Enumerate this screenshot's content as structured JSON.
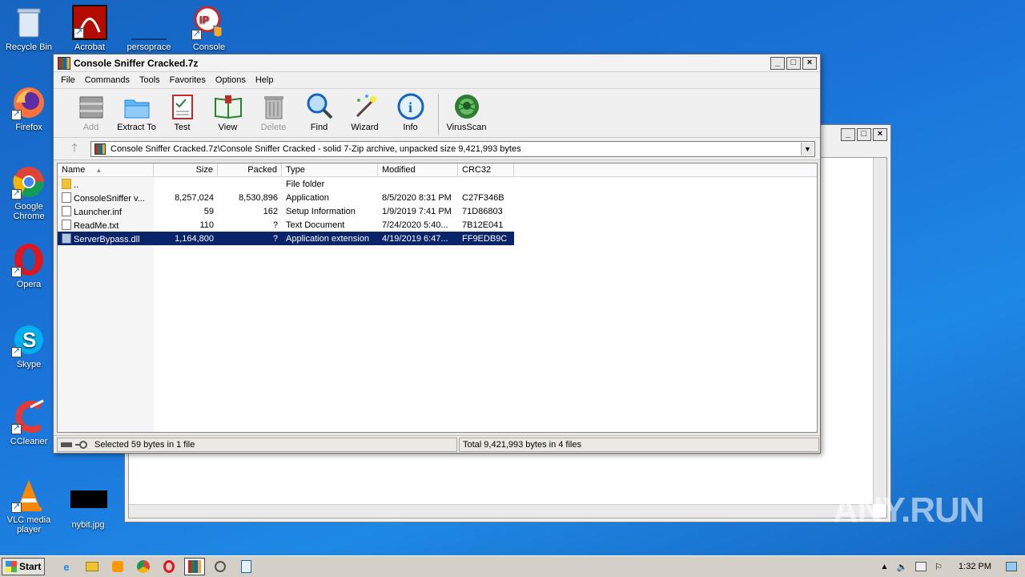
{
  "desktop": {
    "icons": [
      {
        "label": "Recycle Bin",
        "icon": "recycle-bin"
      },
      {
        "label": "Acrobat",
        "icon": "acrobat"
      },
      {
        "label": "persoprace",
        "icon": "blank-file"
      },
      {
        "label": "Console",
        "icon": "ip-console"
      },
      {
        "label": "Firefox",
        "icon": "firefox"
      },
      {
        "label": "Google Chrome",
        "icon": "chrome"
      },
      {
        "label": "Opera",
        "icon": "opera"
      },
      {
        "label": "Skype",
        "icon": "skype"
      },
      {
        "label": "CCleaner",
        "icon": "ccleaner"
      },
      {
        "label": "VLC media player",
        "icon": "vlc"
      },
      {
        "label": "nybit.jpg",
        "icon": "image-file"
      }
    ]
  },
  "window": {
    "title": "Console Sniffer Cracked.7z",
    "controls": [
      "_",
      "□",
      "×"
    ]
  },
  "menu": [
    "File",
    "Commands",
    "Tools",
    "Favorites",
    "Options",
    "Help"
  ],
  "toolbar": [
    {
      "label": "Add",
      "icon": "add-archive-icon",
      "disabled": true
    },
    {
      "label": "Extract To",
      "icon": "extract-folder-icon",
      "disabled": false
    },
    {
      "label": "Test",
      "icon": "test-checklist-icon",
      "disabled": false
    },
    {
      "label": "View",
      "icon": "view-book-icon",
      "disabled": false
    },
    {
      "label": "Delete",
      "icon": "delete-trash-icon",
      "disabled": true
    },
    {
      "label": "Find",
      "icon": "find-magnifier-icon",
      "disabled": false
    },
    {
      "label": "Wizard",
      "icon": "wizard-wand-icon",
      "disabled": false
    },
    {
      "label": "Info",
      "icon": "info-icon",
      "disabled": false
    },
    {
      "label": "VirusScan",
      "icon": "virus-scan-icon",
      "disabled": false
    }
  ],
  "address": {
    "path": "Console Sniffer Cracked.7z\\Console Sniffer Cracked - solid 7-Zip archive, unpacked size 9,421,993 bytes"
  },
  "table": {
    "columns": [
      "Name",
      "Size",
      "Packed",
      "Type",
      "Modified",
      "CRC32"
    ],
    "rows": [
      {
        "name": "..",
        "size": "",
        "packed": "",
        "type": "File folder",
        "modified": "",
        "crc": "",
        "icon": "folder"
      },
      {
        "name": "ConsoleSniffer v...",
        "size": "8,257,024",
        "packed": "8,530,896",
        "type": "Application",
        "modified": "8/5/2020 8:31 PM",
        "crc": "C27F346B",
        "icon": "exe"
      },
      {
        "name": "Launcher.inf",
        "size": "59",
        "packed": "162",
        "type": "Setup Information",
        "modified": "1/9/2019 7:41 PM",
        "crc": "71D86803",
        "icon": "inf"
      },
      {
        "name": "ReadMe.txt",
        "size": "110",
        "packed": "?",
        "type": "Text Document",
        "modified": "7/24/2020 5:40...",
        "crc": "7B12E041",
        "icon": "txt"
      },
      {
        "name": "ServerBypass.dll",
        "size": "1,164,800",
        "packed": "?",
        "type": "Application extension",
        "modified": "4/19/2019 6:47...",
        "crc": "FF9EDB9C",
        "icon": "dll",
        "selected": true
      }
    ]
  },
  "status": {
    "left": "Selected 59 bytes in 1 file",
    "right": "Total 9,421,993 bytes in 4 files"
  },
  "taskbar": {
    "start": "Start",
    "clock": "1:32 PM"
  },
  "watermark": "ANY.RUN"
}
